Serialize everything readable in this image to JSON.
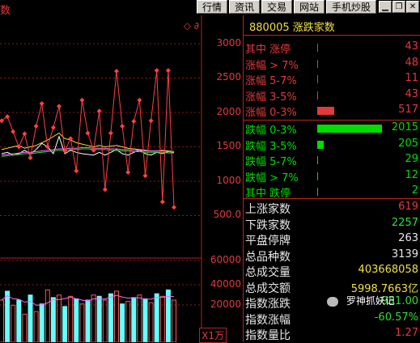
{
  "header": {
    "title_fragment": "数",
    "tabs": [
      "行情",
      "资讯",
      "交易",
      "网站",
      "手机炒股"
    ],
    "window_buttons": [
      "minimize-icon",
      "restore-icon",
      "close-icon"
    ]
  },
  "chart": {
    "marker": "◇ ∂",
    "price_axis": [
      "3000",
      "2500",
      "2000",
      "1500",
      "1000",
      "500.0"
    ],
    "volume_axis": [
      "60000",
      "40000",
      "20000"
    ],
    "unit": "X1万"
  },
  "chart_data": [
    {
      "type": "line",
      "series": [
        {
          "values": [
            1880,
            1940,
            1720,
            1500,
            1690,
            1340,
            1800,
            2130,
            1500,
            1780,
            2090,
            1440,
            1620,
            1150,
            2180,
            1700,
            1450,
            2020,
            880,
            1700,
            2600,
            1800,
            1130,
            1870,
            2180,
            1080,
            1880,
            2610,
            700,
            2610,
            620
          ]
        },
        {
          "values": [
            1400,
            1420,
            1380,
            1400,
            1450,
            1400,
            1460,
            1550,
            1500,
            1400,
            1650,
            1400,
            1450,
            1420,
            1400,
            1390,
            1380,
            1420,
            1380,
            1420,
            1460,
            1400,
            1380,
            1420,
            1450,
            1400,
            1380,
            1420,
            1400,
            1430,
            1420
          ]
        },
        {
          "values": [
            1460,
            1480,
            1500,
            1520,
            1480,
            1500,
            1520,
            1560,
            1600,
            1650,
            1700,
            1620,
            1600,
            1560,
            1540,
            1520,
            1500,
            1520,
            1500,
            1510,
            1520,
            1500,
            1480,
            1470,
            1460,
            1450,
            1440,
            1440,
            1450,
            1440,
            1430
          ]
        },
        {
          "values": [
            1380,
            1390,
            1400,
            1410,
            1420,
            1420,
            1430,
            1440,
            1450,
            1460,
            1470,
            1470,
            1480,
            1480,
            1490,
            1490,
            1480,
            1480,
            1480,
            1470,
            1470,
            1460,
            1460,
            1450,
            1450,
            1440,
            1440,
            1440,
            1440,
            1430,
            1430
          ]
        }
      ],
      "ylim": [
        400,
        3050
      ]
    },
    {
      "type": "bar",
      "series": [
        {
          "values": [
            33000,
            40000,
            29000,
            33000,
            22000,
            37000,
            24000,
            30000,
            41000,
            35000,
            37000,
            28000,
            36000,
            34000,
            30000,
            33000,
            37000,
            36000,
            33000,
            38000,
            40000,
            30000,
            32000,
            35000,
            37000,
            34000,
            31000,
            38000,
            36000,
            41000,
            33000
          ]
        }
      ],
      "ylim": [
        0,
        66000
      ]
    }
  ],
  "panel": {
    "header": "880005 涨跌家数",
    "up_rows": [
      {
        "label": "其中 涨停",
        "value": "43",
        "bar": 0.01
      },
      {
        "label": "涨幅 > 7%",
        "value": "48",
        "bar": 0.01
      },
      {
        "label": "涨幅 5-7%",
        "value": "11",
        "bar": 0.01
      },
      {
        "label": "涨幅 3-5%",
        "value": "43",
        "bar": 0.01
      },
      {
        "label": "涨幅 0-3%",
        "value": "517",
        "bar": 0.26
      }
    ],
    "down_rows": [
      {
        "label": "跌幅 0-3%",
        "value": "2015",
        "bar": 1.0
      },
      {
        "label": "跌幅 3-5%",
        "value": "205",
        "bar": 0.1
      },
      {
        "label": "跌幅 5-7%",
        "value": "29",
        "bar": 0.01
      },
      {
        "label": "跌幅 > 7%",
        "value": "12",
        "bar": 0.01
      },
      {
        "label": "其中 跌停",
        "value": "2",
        "bar": 0.01
      }
    ],
    "stats": [
      {
        "label": "上涨家数",
        "value": "619",
        "color": "#e23a3a"
      },
      {
        "label": "下跌家数",
        "value": "2257",
        "color": "#33dd33"
      },
      {
        "label": "平盘停牌",
        "value": "263",
        "color": "#e8e8e8"
      },
      {
        "label": "总品种数",
        "value": "3139",
        "color": "#e8e8e8"
      },
      {
        "label": "总成交量",
        "value": "403668058",
        "color": "#f0e040"
      },
      {
        "label": "总成交额",
        "value": "5998.7663亿",
        "color": "#f0e040"
      },
      {
        "label": "指数涨跌",
        "value": "-951.00",
        "color": "#33dd33"
      },
      {
        "label": "指数涨幅",
        "value": "-60.57%",
        "color": "#33dd33"
      },
      {
        "label": "指数量比",
        "value": "1.27",
        "color": "#e23a3a"
      }
    ]
  },
  "watermark": "罗神抓妖记",
  "colors": {
    "up": "#e23a3a",
    "down": "#00dd00",
    "accent": "#f0e040",
    "frame": "#b22222"
  }
}
